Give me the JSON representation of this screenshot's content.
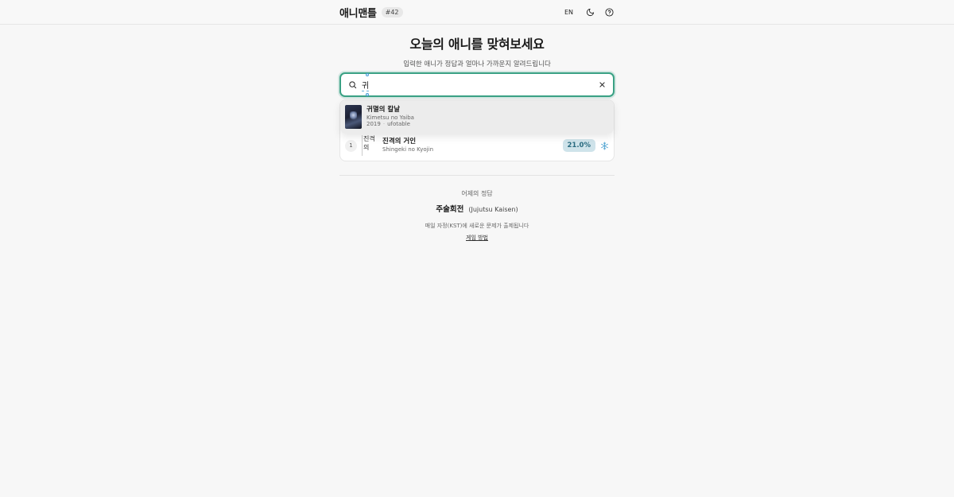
{
  "header": {
    "logo": "애니맨틀",
    "round": "#42",
    "lang": "EN",
    "icons": {
      "theme": "moon-icon",
      "help": "help-circle-icon"
    }
  },
  "hero": {
    "title": "오늘의 애니를 맞혀보세요",
    "subtitle": "입력한 애니가 정답과 얼마나 가까운지 알려드립니다"
  },
  "search": {
    "value": "귀",
    "icon": "search-icon",
    "clear_icon": "close-icon",
    "accent": "#3aa184"
  },
  "suggestions": [
    {
      "title": "귀멸의 칼날",
      "subtitle": "Kimetsu no Yaiba",
      "year": "2019",
      "studio": "ufotable"
    }
  ],
  "guesses": [
    {
      "number": "1",
      "image_alt": "진격의",
      "title": "진격의 거인",
      "subtitle": "Shingeki no Kyojin",
      "score": "21.0%",
      "icon": "snowflake-icon",
      "score_color": "#2a6b80"
    }
  ],
  "yesterday": {
    "label": "어제의 정답",
    "answer_ko": "주술회전",
    "answer_en": "(Jujutsu Kaisen)",
    "daily_note": "매일 자정(KST)에 새로운 문제가 출제됩니다",
    "howto_link": "게임 방법"
  }
}
